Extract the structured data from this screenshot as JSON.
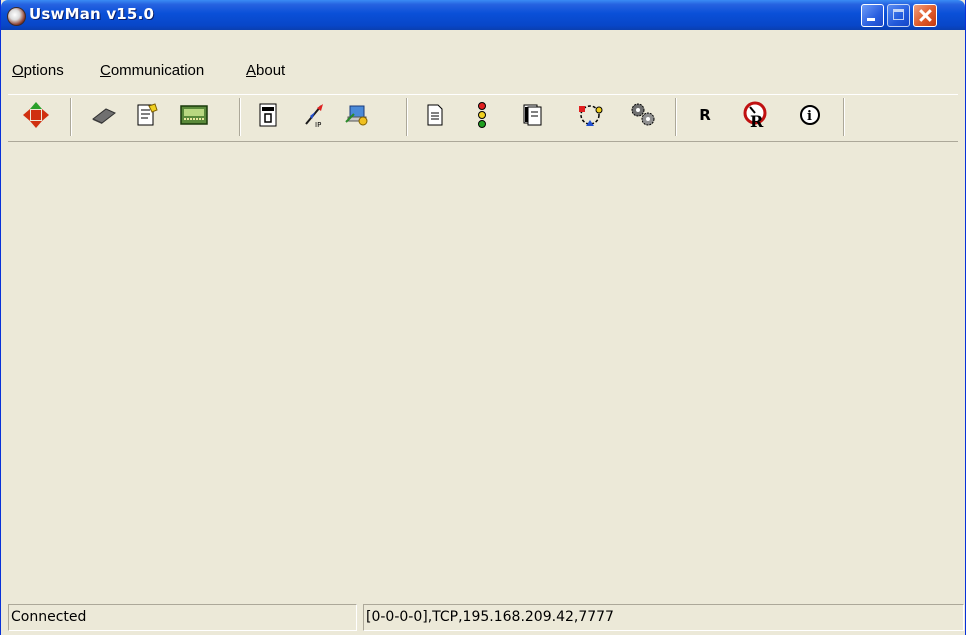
{
  "window": {
    "title": "UswMan v15.0"
  },
  "menu": [
    {
      "label": "Options",
      "mnemonic": "O",
      "rest": "ptions"
    },
    {
      "label": "Communication",
      "mnemonic": "C",
      "rest": "ommunication"
    },
    {
      "label": "About",
      "mnemonic": "A",
      "rest": "bout"
    }
  ],
  "toolbar": {
    "buttons": [
      {
        "icon": "move-arrows-icon"
      },
      {
        "icon": "chip-icon"
      },
      {
        "icon": "document-edit-icon"
      },
      {
        "icon": "board-icon"
      },
      {
        "icon": "calendar-icon"
      },
      {
        "icon": "ip-pen-icon"
      },
      {
        "icon": "network-icon"
      },
      {
        "icon": "page-icon"
      },
      {
        "icon": "traffic-light-icon"
      },
      {
        "icon": "pages-icon"
      },
      {
        "icon": "cycle-icon"
      },
      {
        "icon": "gears-icon"
      },
      {
        "icon": "r-letter-icon",
        "label": "R"
      },
      {
        "icon": "gauge-r-icon",
        "label": "R"
      },
      {
        "icon": "info-icon",
        "label": "i"
      }
    ]
  },
  "status": {
    "state": "Connected",
    "connection": "[0-0-0-0],TCP,195.168.209.42,7777"
  },
  "colors": {
    "titlebar": "#0a50d8",
    "face": "#ece9d8",
    "close": "#e05a2a"
  }
}
